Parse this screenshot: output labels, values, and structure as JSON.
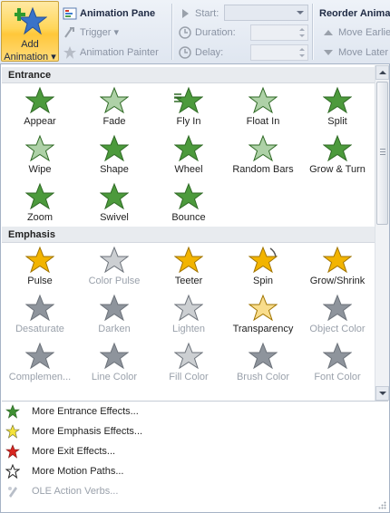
{
  "ribbon": {
    "add_animation": {
      "line1": "Add",
      "line2": "Animation ▾"
    },
    "animation_pane": "Animation Pane",
    "trigger": "Trigger ▾",
    "animation_painter": "Animation Painter",
    "start_label": "Start:",
    "duration_label": "Duration:",
    "delay_label": "Delay:",
    "reorder_title": "Reorder Animat",
    "move_earlier": "Move Earlie",
    "move_later": "Move Later"
  },
  "sections": {
    "entrance": {
      "title": "Entrance",
      "items": [
        "Appear",
        "Fade",
        "Fly In",
        "Float In",
        "Split",
        "Wipe",
        "Shape",
        "Wheel",
        "Random Bars",
        "Grow & Turn",
        "Zoom",
        "Swivel",
        "Bounce"
      ]
    },
    "emphasis": {
      "title": "Emphasis",
      "items": [
        "Pulse",
        "Color Pulse",
        "Teeter",
        "Spin",
        "Grow/Shrink",
        "Desaturate",
        "Darken",
        "Lighten",
        "Transparency",
        "Object Color",
        "Complemen...",
        "Line Color",
        "Fill Color",
        "Brush Color",
        "Font Color"
      ]
    }
  },
  "more_menu": [
    {
      "label": "More Entrance Effects...",
      "icon": "green-star-icon"
    },
    {
      "label": "More Emphasis Effects...",
      "icon": "yellow-star-icon"
    },
    {
      "label": "More Exit Effects...",
      "icon": "red-star-icon"
    },
    {
      "label": "More Motion Paths...",
      "icon": "outline-star-icon"
    },
    {
      "label": "OLE Action Verbs...",
      "icon": "ole-verbs-icon"
    }
  ],
  "colors": {
    "entrance_green": "#4c9a3c",
    "emphasis_gold": "#f2b400",
    "disabled_gray": "#9aa1ab",
    "exit_red": "#d8251f"
  }
}
